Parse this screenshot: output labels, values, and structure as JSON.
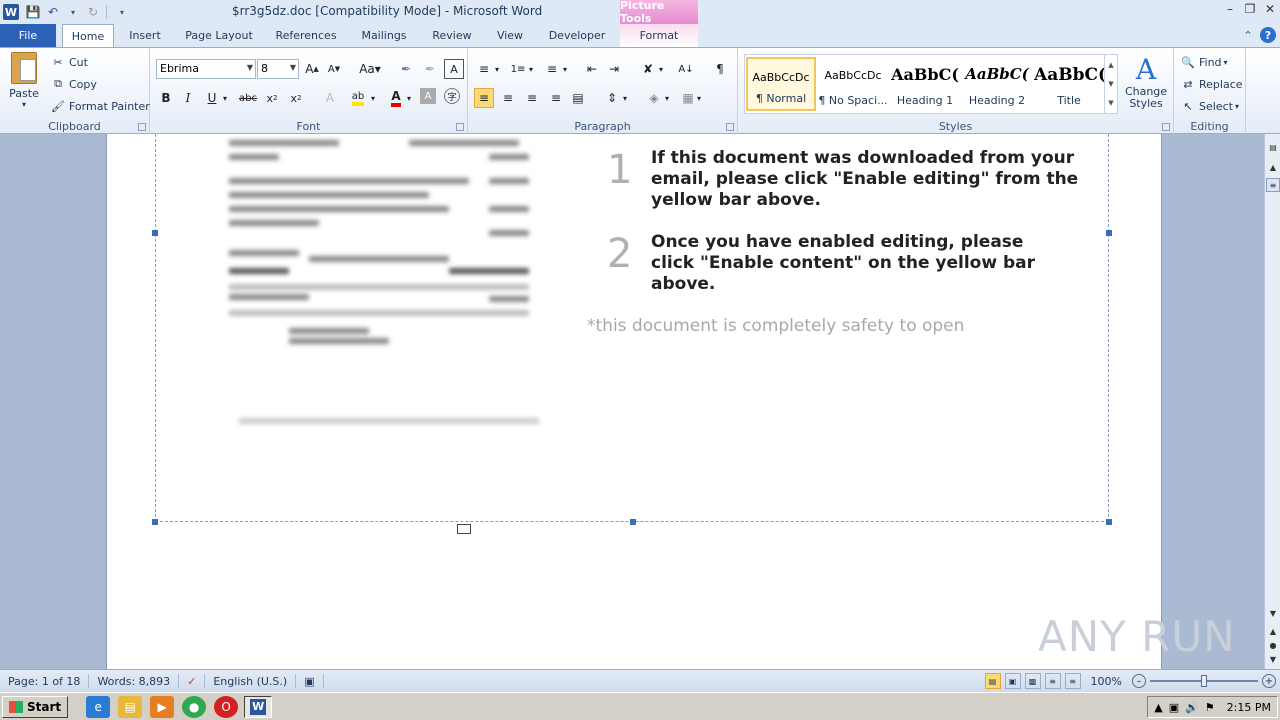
{
  "window": {
    "title": "$rr3g5dz.doc [Compatibility Mode]  -  Microsoft Word",
    "contextual_tab_group": "Picture Tools"
  },
  "tabs": [
    "File",
    "Home",
    "Insert",
    "Page Layout",
    "References",
    "Mailings",
    "Review",
    "View",
    "Developer",
    "Format"
  ],
  "clipboard": {
    "paste": "Paste",
    "cut": "Cut",
    "copy": "Copy",
    "format_painter": "Format Painter",
    "label": "Clipboard"
  },
  "font": {
    "family": "Ebrima",
    "size": "8",
    "label": "Font"
  },
  "paragraph": {
    "label": "Paragraph"
  },
  "styles": {
    "label": "Styles",
    "items": [
      {
        "preview": "AaBbCcDc",
        "name": "¶ Normal"
      },
      {
        "preview": "AaBbCcDc",
        "name": "¶ No Spaci..."
      },
      {
        "preview": "AaBbC(",
        "name": "Heading 1"
      },
      {
        "preview": "AaBbC(",
        "name": "Heading 2"
      },
      {
        "preview": "AaBbC(",
        "name": "Title"
      }
    ],
    "change_styles_line1": "Change",
    "change_styles_line2": "Styles"
  },
  "editing": {
    "find": "Find",
    "replace": "Replace",
    "select": "Select",
    "label": "Editing"
  },
  "document": {
    "step1_num": "1",
    "step1_text": "If this document was downloaded from your email, please click \"Enable editing\" from the yellow bar above.",
    "step2_num": "2",
    "step2_text": "Once you have enabled editing, please click \"Enable content\" on the yellow bar above.",
    "safety_note": "*this document is completely safety to open"
  },
  "statusbar": {
    "page": "Page: 1 of 18",
    "words": "Words: 8,893",
    "language": "English (U.S.)",
    "zoom": "100%",
    "zoom_level": 0.5
  },
  "watermark": "ANY RUN",
  "taskbar": {
    "start": "Start",
    "clock": "2:15 PM"
  }
}
